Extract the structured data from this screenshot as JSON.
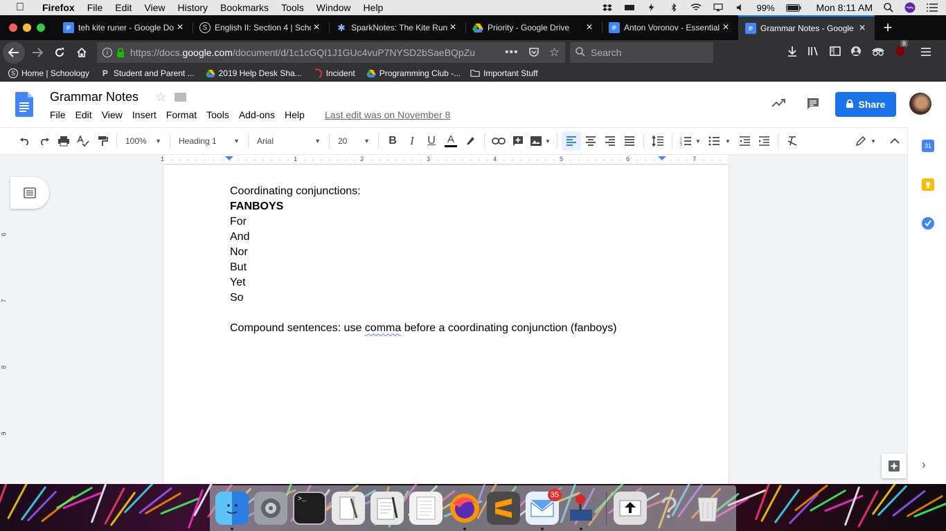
{
  "macbar": {
    "app": "Firefox",
    "menus": [
      "File",
      "Edit",
      "View",
      "History",
      "Bookmarks",
      "Tools",
      "Window",
      "Help"
    ],
    "battery": "99%",
    "clock": "Mon 8:11 AM"
  },
  "tabs": [
    {
      "title": "teh kite runer - Google Do",
      "icon": "docs-icon",
      "active": false
    },
    {
      "title": "English II: Section 4 | Scho",
      "icon": "schoology-icon",
      "active": false
    },
    {
      "title": "SparkNotes: The Kite Runn",
      "icon": "sparknotes-icon",
      "active": false
    },
    {
      "title": "Priority - Google Drive",
      "icon": "drive-icon",
      "active": false
    },
    {
      "title": "Anton Voronov - Essential",
      "icon": "docs-icon",
      "active": false
    },
    {
      "title": "Grammar Notes - Google D",
      "icon": "docs-icon",
      "active": true
    }
  ],
  "navbar": {
    "url_prefix": "https://docs.",
    "url_domain": "google.com",
    "url_rest": "/document/d/1c1cGQI1J1GUc4vuP7NYSD2bSaeBQpZu",
    "search_placeholder": "Search",
    "addon_badge": "8"
  },
  "bookmarks": [
    {
      "label": "Home | Schoology",
      "icon": "schoology-icon"
    },
    {
      "label": "Student and Parent ...",
      "icon": "p-icon"
    },
    {
      "label": "2019 Help Desk Sha...",
      "icon": "drive-icon"
    },
    {
      "label": "Incident",
      "icon": "incident-icon"
    },
    {
      "label": "Programming Club -...",
      "icon": "drive-icon"
    },
    {
      "label": "Important Stuff",
      "icon": "folder-icon"
    }
  ],
  "docs": {
    "title": "Grammar Notes",
    "menus": [
      "File",
      "Edit",
      "View",
      "Insert",
      "Format",
      "Tools",
      "Add-ons",
      "Help"
    ],
    "last_edit": "Last edit was on November 8",
    "share_label": "Share"
  },
  "toolbar": {
    "zoom": "100%",
    "style": "Heading 1",
    "font": "Arial",
    "size": "20"
  },
  "ruler": {
    "hmarks": [
      "1",
      "1",
      "2",
      "3",
      "4",
      "5",
      "6",
      "7"
    ],
    "vmarks": [
      "6",
      "7",
      "8",
      "9"
    ]
  },
  "document": {
    "heading": "Coordinating conjunctions:",
    "acronym": "FANBOYS",
    "items": [
      "For",
      "And",
      "Nor",
      "But",
      "Yet",
      "So"
    ],
    "note_before": "Compound sentences: use ",
    "note_flagged": "comma",
    "note_after": " before a coordinating conjunction (fanboys)"
  },
  "dock": {
    "mail_badge": "35"
  },
  "colors": {
    "accent": "#1a73e8",
    "tab_highlight": "#0a84ff",
    "firefox_dark": "#0c0c0d"
  }
}
